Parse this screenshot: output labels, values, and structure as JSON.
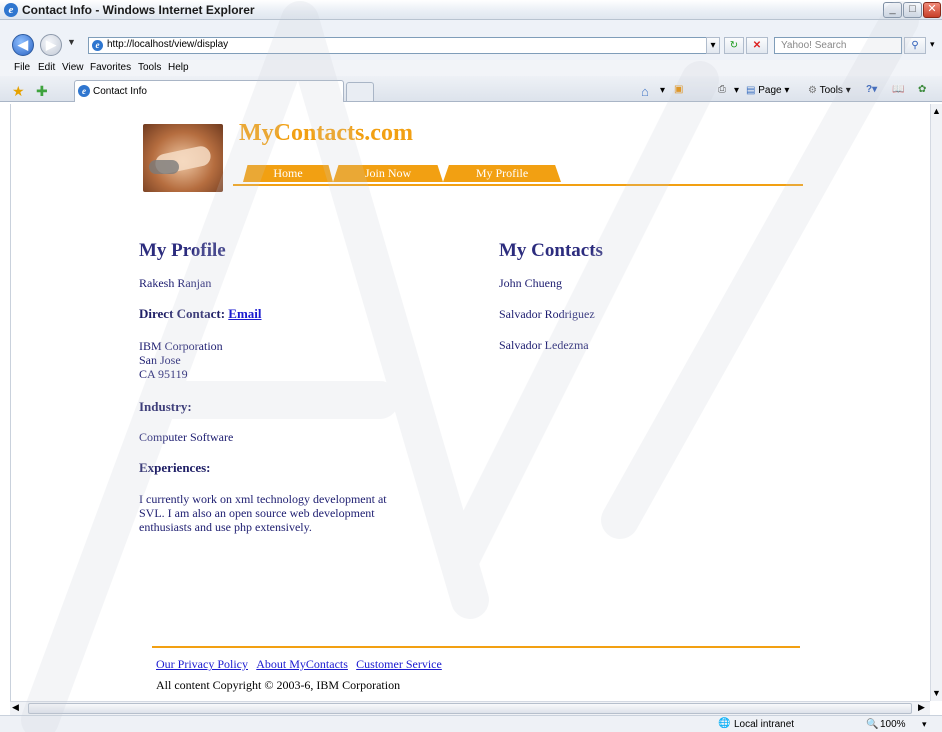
{
  "window": {
    "title": "Contact Info - Windows Internet Explorer"
  },
  "address": {
    "url": "http://localhost/view/display",
    "search_placeholder": "Yahoo! Search"
  },
  "menu": {
    "items": [
      "File",
      "Edit",
      "View",
      "Favorites",
      "Tools",
      "Help"
    ]
  },
  "tab": {
    "label": "Contact Info"
  },
  "commands": {
    "page": "Page",
    "tools": "Tools"
  },
  "site": {
    "name": "MyContacts.com",
    "nav": [
      "Home",
      "Join Now",
      "My Profile"
    ]
  },
  "profile": {
    "heading": "My Profile",
    "name": "Rakesh Ranjan",
    "direct_contact_label": "Direct Contact:",
    "email_link": "Email",
    "address": [
      "IBM Corporation",
      "San Jose",
      "CA 95119"
    ],
    "industry_heading": "Industry:",
    "industry": "Computer Software",
    "experiences_heading": "Experiences:",
    "experiences": [
      "I currently work on xml technology development at",
      "SVL. I am also an open source web development",
      "enthusiasts and use php extensively."
    ]
  },
  "contacts": {
    "heading": "My Contacts",
    "items": [
      "John Chueng",
      "Salvador Rodriguez",
      "Salvador Ledezma"
    ]
  },
  "footer": {
    "links": [
      "Our Privacy Policy",
      "About MyContacts",
      "Customer Service"
    ],
    "copyright": "All content Copyright © 2003-6, IBM Corporation"
  },
  "status": {
    "zone": "Local intranet",
    "zoom": "100%"
  },
  "colors": {
    "accent": "#f2a012",
    "heading": "#2c2c7e",
    "link": "#1a1ad0"
  }
}
